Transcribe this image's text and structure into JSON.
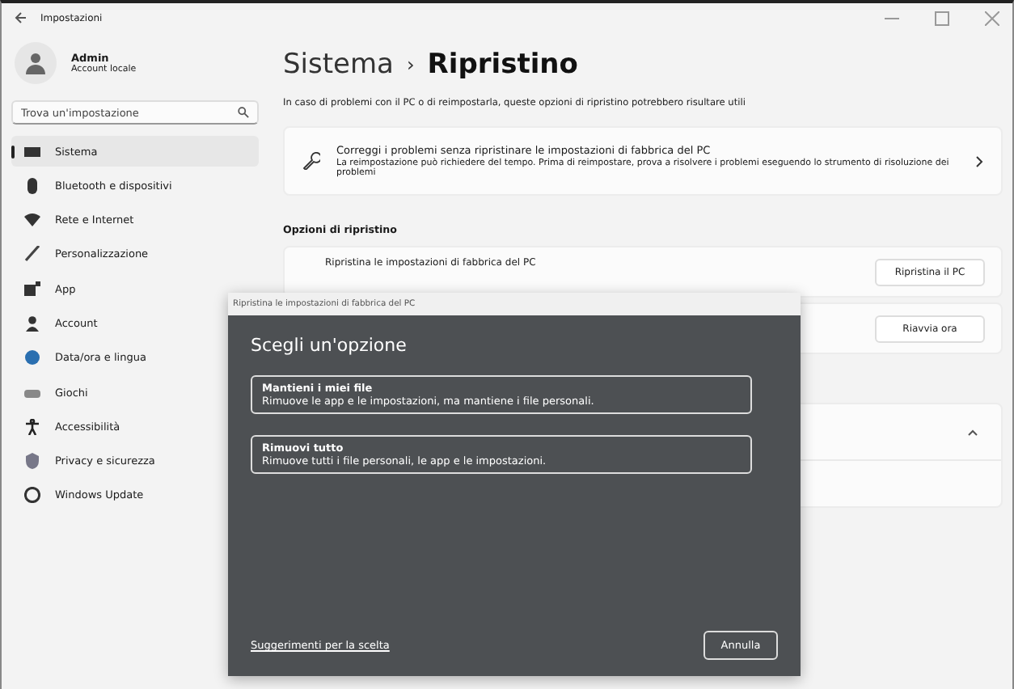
{
  "window": {
    "title": "Impostazioni"
  },
  "user": {
    "name": "Admin",
    "subtitle": "Account locale"
  },
  "search": {
    "placeholder": "Trova un'impostazione"
  },
  "sidebar": {
    "items": [
      {
        "label": "Sistema",
        "selected": true
      },
      {
        "label": "Bluetooth e dispositivi",
        "selected": false
      },
      {
        "label": "Rete e Internet",
        "selected": false
      },
      {
        "label": "Personalizzazione",
        "selected": false
      },
      {
        "label": "App",
        "selected": false
      },
      {
        "label": "Account",
        "selected": false
      },
      {
        "label": "Data/ora e lingua",
        "selected": false
      },
      {
        "label": "Giochi",
        "selected": false
      },
      {
        "label": "Accessibilità",
        "selected": false
      },
      {
        "label": "Privacy e sicurezza",
        "selected": false
      },
      {
        "label": "Windows Update",
        "selected": false
      }
    ]
  },
  "breadcrumb": {
    "parent": "Sistema",
    "separator": "›",
    "current": "Ripristino"
  },
  "description": "In caso di problemi con il PC o di reimpostarla, queste opzioni di ripristino potrebbero risultare utili",
  "fix_card": {
    "title": "Correggi i problemi senza ripristinare le impostazioni di fabbrica del PC",
    "text": "La reimpostazione può richiedere del tempo. Prima di reimpostare, prova a risolvere i problemi eseguendo lo strumento di risoluzione dei problemi"
  },
  "section_title": "Opzioni di ripristino",
  "options": [
    {
      "label": "Ripristina le impostazioni di fabbrica del PC",
      "button": "Ripristina il PC"
    },
    {
      "button": "Riavvia ora"
    }
  ],
  "dialog": {
    "title": "Ripristina le impostazioni di fabbrica del PC",
    "heading": "Scegli un'opzione",
    "choices": [
      {
        "title": "Mantieni i miei file",
        "text": "Rimuove le app e le impostazioni, ma mantiene i file personali."
      },
      {
        "title": "Rimuovi tutto",
        "text": "Rimuove tutti i file personali, le app e le impostazioni."
      }
    ],
    "link": "Suggerimenti per la scelta",
    "cancel": "Annulla"
  }
}
